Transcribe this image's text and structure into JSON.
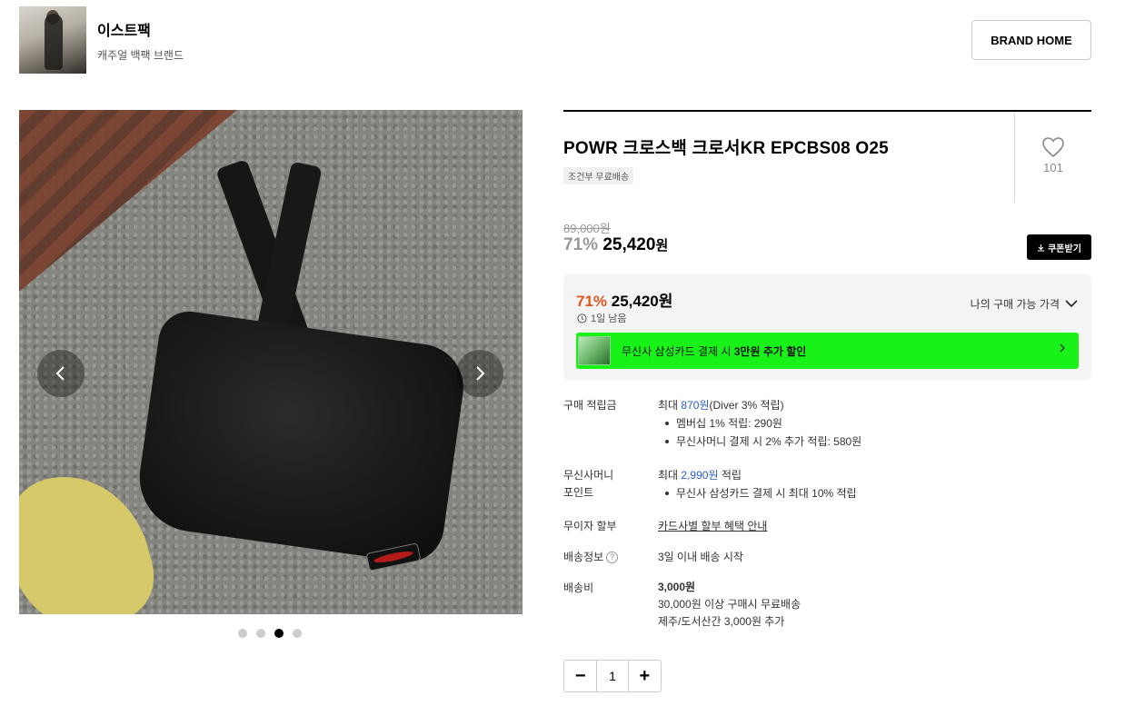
{
  "brand": {
    "name": "이스트팩",
    "description": "캐주얼 백팩 브랜드",
    "home_button": "BRAND HOME"
  },
  "gallery": {
    "total_images": 4,
    "active_index": 3,
    "prev_label": "‹",
    "next_label": "›"
  },
  "product": {
    "title": "POWR 크로스백 크로서KR EPCBS08 O25",
    "shipping_badge": "조건부 무료배송",
    "like_count": "101",
    "original_price": "89,000원",
    "discount_pct": "71%",
    "sale_price": "25,420",
    "price_unit": "원",
    "coupon_button": "쿠폰받기"
  },
  "best_price": {
    "discount_pct": "71%",
    "price": "25,420원",
    "time_left": "1일 남음",
    "my_price_label": "나의 구매 가능 가격",
    "promo_prefix": "무신사 삼성카드 결제 시 ",
    "promo_bold": "3만원 추가 할인",
    "promo_color": "#19f219"
  },
  "points": {
    "label": "구매 적립금",
    "max_prefix": "최대 ",
    "max_value": "870원",
    "max_suffix": "(Diver 3% 적립)",
    "items": [
      "멤버십 1% 적립: 290원",
      "무신사머니 결제 시 2% 추가 적립: 580원"
    ]
  },
  "money_points": {
    "label_line1": "무신사머니",
    "label_line2": "포인트",
    "max_prefix": "최대 ",
    "max_value": "2,990원",
    "max_suffix": " 적립",
    "items": [
      "무신사 삼성카드 결제 시 최대 10% 적립"
    ]
  },
  "installment": {
    "label": "무이자 할부",
    "link": "카드사별 할부 혜택 안내"
  },
  "shipping_info": {
    "label": "배송정보",
    "value": "3일 이내 배송 시작"
  },
  "shipping_fee": {
    "label": "배송비",
    "fee": "3,000원",
    "free_condition": "30,000원 이상 구매시 무료배송",
    "island_extra": "제주/도서산간 3,000원 추가"
  },
  "quantity": {
    "minus": "−",
    "value": "1",
    "plus": "+"
  }
}
